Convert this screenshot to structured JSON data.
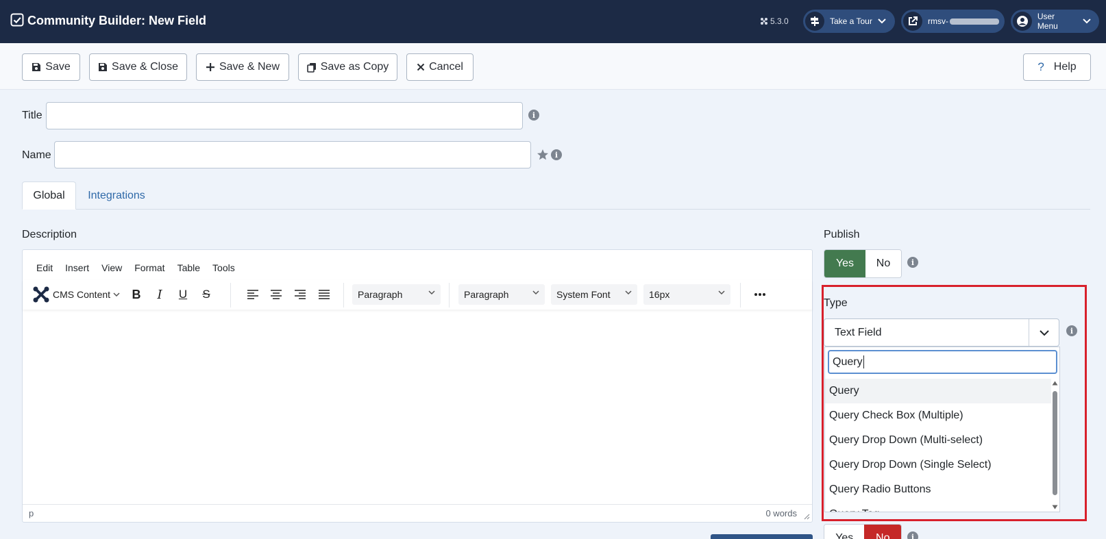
{
  "header": {
    "title": "Community Builder: New Field",
    "version": "5.3.0",
    "tour_label": "Take a Tour",
    "site_label": "rmsv-",
    "user_menu_label": "User Menu"
  },
  "toolbar": {
    "save": "Save",
    "save_close": "Save & Close",
    "save_new": "Save & New",
    "save_copy": "Save as Copy",
    "cancel": "Cancel",
    "help": "Help"
  },
  "form": {
    "title_label": "Title",
    "title_value": "",
    "name_label": "Name",
    "name_value": ""
  },
  "tabs": [
    {
      "label": "Global",
      "active": true
    },
    {
      "label": "Integrations",
      "active": false
    }
  ],
  "editor": {
    "section_label": "Description",
    "menu": [
      "Edit",
      "Insert",
      "View",
      "Format",
      "Table",
      "Tools"
    ],
    "cms_content": "CMS Content",
    "block_format_1": "Paragraph",
    "block_format_2": "Paragraph",
    "font_family": "System Font",
    "font_size": "16px",
    "path": "p",
    "word_count": "0 words"
  },
  "publish": {
    "label": "Publish",
    "yes": "Yes",
    "no": "No",
    "value": "Yes"
  },
  "type": {
    "label": "Type",
    "selected": "Text Field",
    "search_value": "Query",
    "options": [
      "Query",
      "Query Check Box (Multiple)",
      "Query Drop Down (Multi-select)",
      "Query Drop Down (Single Select)",
      "Query Radio Buttons",
      "Query Tag"
    ]
  },
  "lower_toggle": {
    "yes": "Yes",
    "no": "No",
    "value": "No"
  },
  "colors": {
    "header_bg": "#1c2a45",
    "accent_blue": "#2f69a8",
    "yes_green": "#437a4f",
    "no_red": "#c52827",
    "highlight_red": "#d8202b"
  }
}
